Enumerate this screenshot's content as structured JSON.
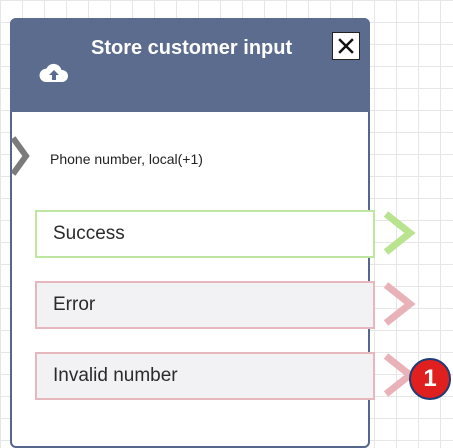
{
  "block": {
    "title": "Store customer input",
    "subtitle": "Phone number, local(+1)",
    "icon": "cloud-upload-icon",
    "close_icon": "close-icon",
    "header_color": "#5c6c8e"
  },
  "branches": [
    {
      "label": "Success",
      "status": "success",
      "border_color": "#bfe6a0",
      "arrow_color": "#b9e48f"
    },
    {
      "label": "Error",
      "status": "error",
      "border_color": "#e6b8bd",
      "arrow_color": "#e8b2b8"
    },
    {
      "label": "Invalid number",
      "status": "error",
      "border_color": "#e6b8bd",
      "arrow_color": "#e8b2b8"
    }
  ],
  "badge": {
    "count": "1",
    "color": "#e01f1f"
  }
}
